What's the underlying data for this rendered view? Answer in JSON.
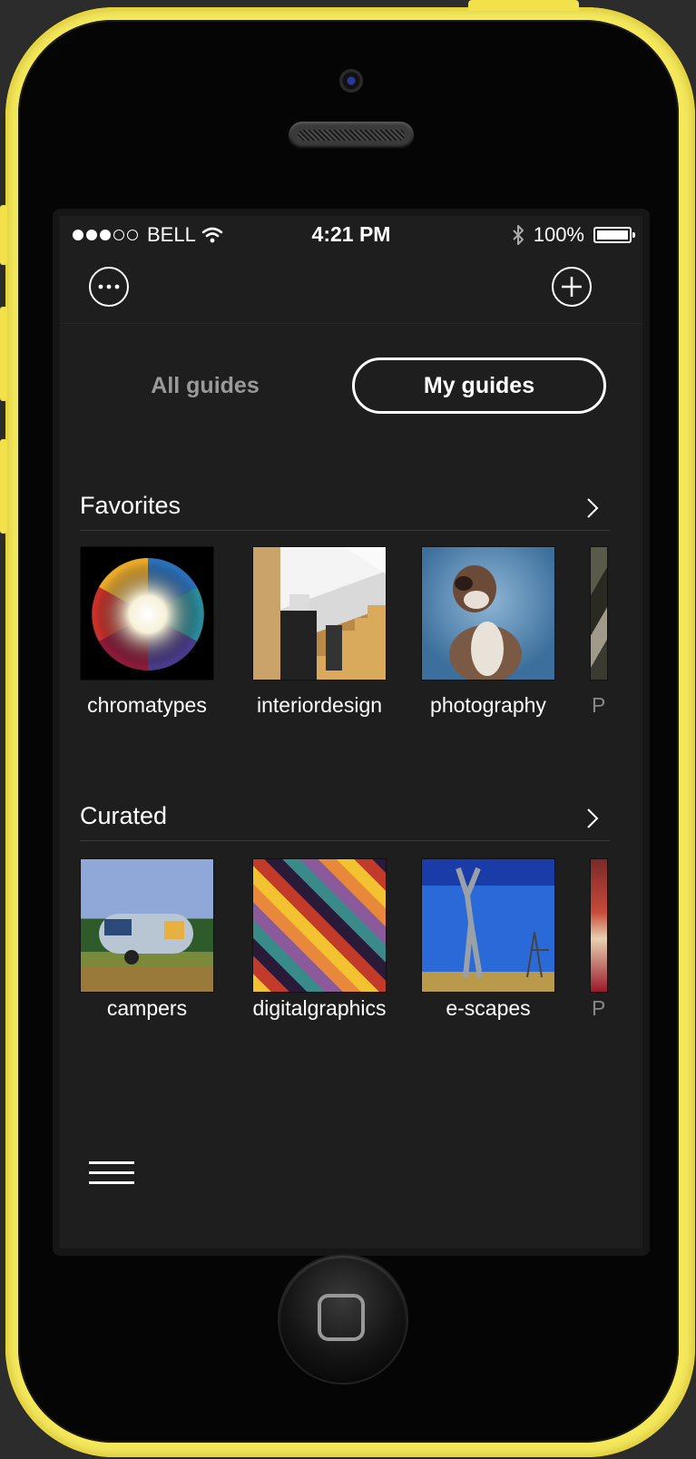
{
  "status_bar": {
    "carrier": "BELL",
    "time": "4:21 PM",
    "battery": "100%",
    "signal_strength": 3,
    "signal_max": 5
  },
  "toolbar": {
    "more_icon": "more-icon",
    "add_icon": "plus-icon"
  },
  "tabs": [
    {
      "label": "All guides",
      "selected": false
    },
    {
      "label": "My guides",
      "selected": true
    }
  ],
  "sections": [
    {
      "title": "Favorites",
      "items": [
        {
          "label": "chromatypes"
        },
        {
          "label": "interiordesign"
        },
        {
          "label": "photography"
        },
        {
          "label": "P"
        }
      ]
    },
    {
      "title": "Curated",
      "items": [
        {
          "label": "campers"
        },
        {
          "label": "digitalgraphics"
        },
        {
          "label": "e-scapes"
        },
        {
          "label": "P"
        }
      ]
    }
  ],
  "colors": {
    "phone_case": "#f5e85a",
    "screen_bg": "#1e1e1e",
    "text": "#ffffff",
    "inactive_tab": "#9a9a9a"
  }
}
